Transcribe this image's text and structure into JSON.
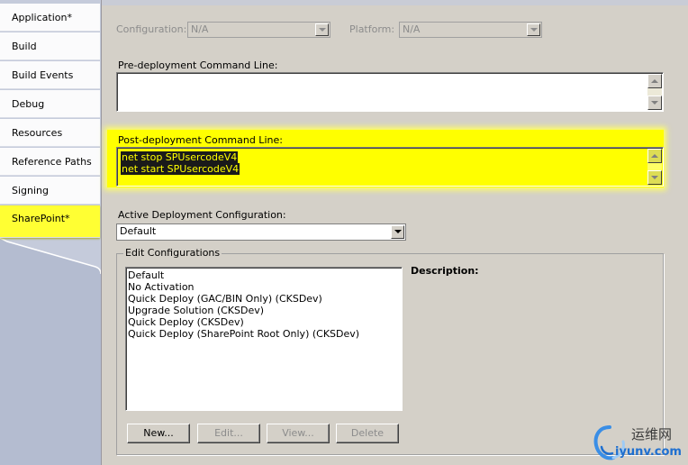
{
  "sidebar": {
    "items": [
      {
        "label": "Application*"
      },
      {
        "label": "Build"
      },
      {
        "label": "Build Events"
      },
      {
        "label": "Debug"
      },
      {
        "label": "Resources"
      },
      {
        "label": "Reference Paths"
      },
      {
        "label": "Signing"
      },
      {
        "label": "SharePoint*"
      }
    ],
    "active_index": 7
  },
  "top": {
    "configuration_label": "Configuration:",
    "configuration_value": "N/A",
    "platform_label": "Platform:",
    "platform_value": "N/A"
  },
  "pre_deploy": {
    "label": "Pre-deployment Command Line:",
    "value": ""
  },
  "post_deploy": {
    "label": "Post-deployment Command Line:",
    "lines": [
      "net stop SPUsercodeV4",
      "net start SPUsercodeV4"
    ]
  },
  "active_config": {
    "label": "Active Deployment Configuration:",
    "value": "Default"
  },
  "edit_configs": {
    "title": "Edit Configurations",
    "items": [
      "Default",
      "No Activation",
      "Quick Deploy (GAC/BIN Only) (CKSDev)",
      "Upgrade Solution (CKSDev)",
      "Quick Deploy (CKSDev)",
      "Quick Deploy (SharePoint Root Only) (CKSDev)"
    ],
    "description_label": "Description:",
    "buttons": {
      "new": "New...",
      "edit": "Edit...",
      "view": "View...",
      "delete": "Delete"
    }
  },
  "watermark": {
    "text_cn": "运维网",
    "text_url": "iyunv.com"
  },
  "colors": {
    "highlight": "#ffff00",
    "accent_blue": "#1e6fd0"
  }
}
